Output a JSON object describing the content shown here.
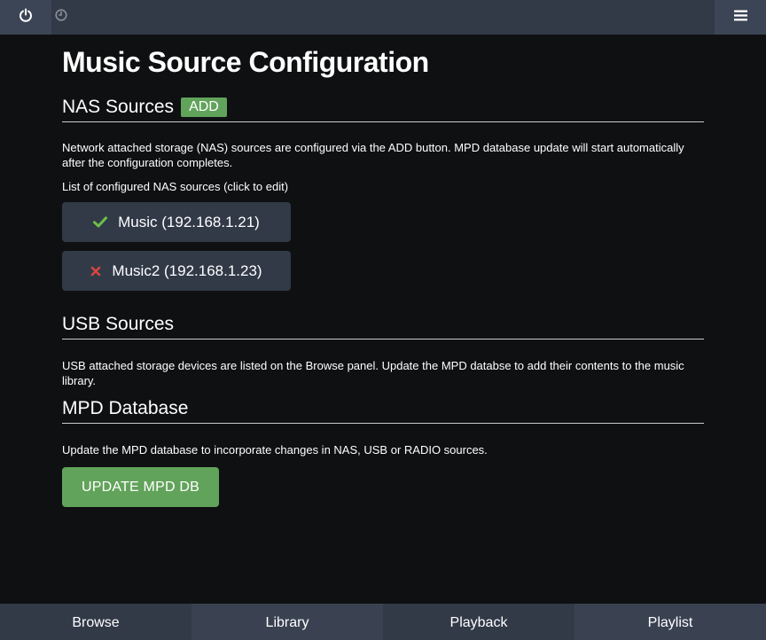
{
  "header": {
    "power_icon": "power-icon",
    "clock_icon": "clock-icon",
    "menu_icon": "hamburger-menu-icon"
  },
  "page": {
    "title": "Music Source Configuration"
  },
  "nas": {
    "title": "NAS Sources",
    "add_label": "ADD",
    "description": "Network attached storage (NAS) sources are configured via the ADD button. MPD database update will start automatically after the configuration completes.",
    "list_label": "List of configured NAS sources (click to edit)",
    "sources": [
      {
        "label": "Music (192.168.1.21)",
        "status": "ok",
        "icon": "checkmark-icon",
        "color": "#6cc04a"
      },
      {
        "label": "Music2 (192.168.1.23)",
        "status": "error",
        "icon": "x-icon",
        "color": "#d9453f"
      }
    ]
  },
  "usb": {
    "title": "USB Sources",
    "description": "USB attached storage devices are listed on the Browse panel. Update the MPD databse to add their contents to the music library."
  },
  "mpd": {
    "title": "MPD Database",
    "description": "Update the MPD database to incorporate changes in NAS, USB or RADIO sources.",
    "update_label": "UPDATE MPD DB"
  },
  "nav": {
    "tabs": [
      "Browse",
      "Library",
      "Playback",
      "Playlist"
    ]
  },
  "colors": {
    "bar": "#323a48",
    "background": "#0e1012",
    "accent_green": "#62a35b"
  }
}
